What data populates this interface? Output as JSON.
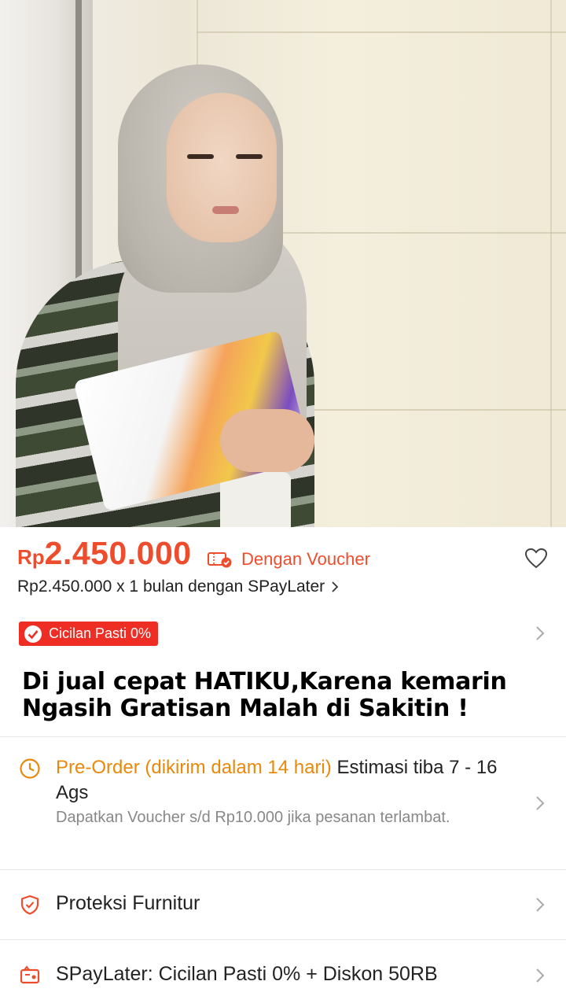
{
  "price": {
    "currency": "Rp",
    "value": "2.450.000",
    "voucher_label": "Dengan Voucher",
    "installment_text": "Rp2.450.000 x 1 bulan dengan SPayLater",
    "accent_color": "#ee4d2d"
  },
  "badge": {
    "label": "Cicilan Pasti 0%",
    "color": "#ee2d24"
  },
  "product": {
    "title": "Di jual cepat HATIKU,Karena kemarin Ngasih Gratisan Malah di Sakitin !"
  },
  "shipping": {
    "preorder_label": "Pre-Order (dikirim dalam 14 hari)",
    "estimate_text": "Estimasi tiba 7 - 16 Ags",
    "voucher_note": "Dapatkan Voucher s/d Rp10.000 jika pesanan terlambat.",
    "icon": "clock-icon",
    "color": "#e8890c"
  },
  "rows": {
    "protection_label": "Proteksi Furnitur",
    "paylater_label": "SPayLater: Cicilan Pasti 0% + Diskon 50RB"
  }
}
